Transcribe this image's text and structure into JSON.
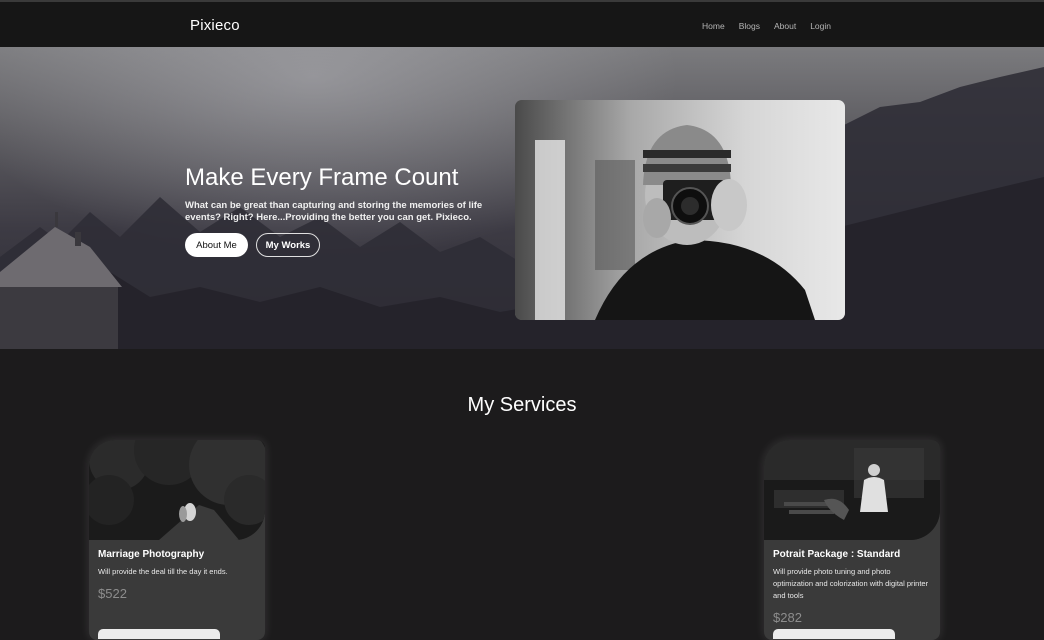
{
  "navbar": {
    "brand": "Pixieco",
    "links": [
      "Home",
      "Blogs",
      "About",
      "Login"
    ]
  },
  "hero": {
    "title": "Make Every Frame Count",
    "subtitle": "What can be great than capturing and storing the memories of life events? Right? Here...Providing the better you can get. Pixieco.",
    "about_button": "About Me",
    "works_button": "My Works"
  },
  "services": {
    "title": "My Services",
    "cards": [
      {
        "title": "Marriage Photography",
        "description": "Will provide the deal till the day it ends.",
        "price": "$522"
      },
      {
        "title": "Potrait Package : Standard",
        "description": "Will provide photo tuning and photo optimization and colorization with digital printer and tools",
        "price": "$282"
      }
    ]
  },
  "colors": {
    "navbar_bg": "#161616",
    "page_bg": "#1c1b1c",
    "card_bg": "#3a3a3a",
    "price": "#8d8d8d"
  }
}
